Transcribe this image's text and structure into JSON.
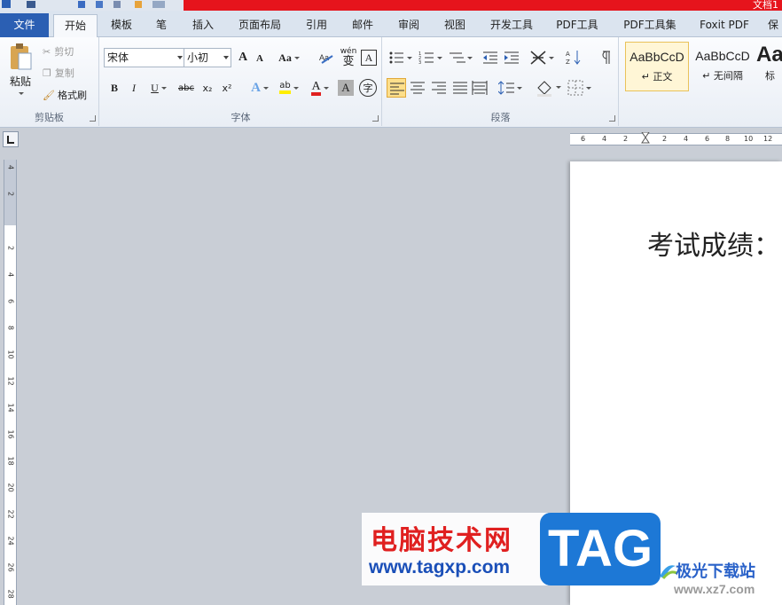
{
  "window": {
    "title_fragment": "文档1"
  },
  "tabs": [
    {
      "label": "文件"
    },
    {
      "label": "开始"
    },
    {
      "label": "模板"
    },
    {
      "label": "笔"
    },
    {
      "label": "插入"
    },
    {
      "label": "页面布局"
    },
    {
      "label": "引用"
    },
    {
      "label": "邮件"
    },
    {
      "label": "审阅"
    },
    {
      "label": "视图"
    },
    {
      "label": "开发工具"
    },
    {
      "label": "PDF工具"
    },
    {
      "label": "PDF工具集"
    },
    {
      "label": "Foxit PDF"
    },
    {
      "label": "保"
    }
  ],
  "clipboard": {
    "paste": "粘贴",
    "cut": "剪切",
    "copy": "复制",
    "format_painter": "格式刷",
    "group": "剪贴板"
  },
  "font": {
    "name": "宋体",
    "size": "小初",
    "change_case": "Aa",
    "bold": "B",
    "italic": "I",
    "underline": "U",
    "strike": "abc",
    "subscript": "x₂",
    "superscript": "x²",
    "highlight": "ab",
    "color": "A",
    "phonetic": "wén",
    "char_border": "A",
    "char_shade": "A",
    "enclose": "字",
    "grow": "A",
    "shrink": "A",
    "group": "字体"
  },
  "paragraph": {
    "group": "段落"
  },
  "styles": [
    {
      "sample": "AaBbCcD",
      "name": "↵ 正文"
    },
    {
      "sample": "AaBbCcD",
      "name": "↵ 无间隔"
    },
    {
      "sample": "Aa",
      "name": "标"
    }
  ],
  "ruler": {
    "h": [
      "6",
      "4",
      "2",
      "2",
      "4",
      "6",
      "8",
      "10",
      "12"
    ],
    "v": [
      "4",
      "2",
      "2",
      "4",
      "6",
      "8",
      "10",
      "12",
      "14",
      "16",
      "18",
      "20",
      "22",
      "24",
      "26",
      "28"
    ]
  },
  "document": {
    "text": "考试成绩："
  },
  "watermark": {
    "site_cn": "电脑技术网",
    "site_url": "www.tagxp.com",
    "tag": "TAG",
    "right_cn": "极光下载站",
    "right_url": "www.xz7.com"
  },
  "colors": {
    "ribbon_bg": "#e9eef5",
    "title_red": "#e6141c",
    "file_tab": "#2b5fb3",
    "workspace": "#c9ced6"
  }
}
